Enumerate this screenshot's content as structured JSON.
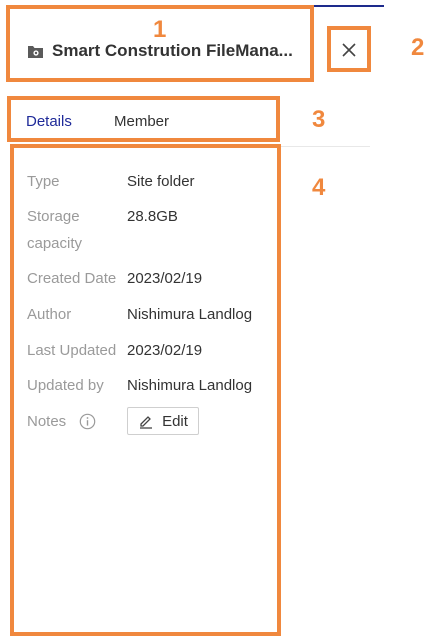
{
  "header": {
    "title": "Smart Constrution FileMana...",
    "close_label": "X"
  },
  "tabs": [
    {
      "label": "Details",
      "active": true
    },
    {
      "label": "Member",
      "active": false
    }
  ],
  "details": {
    "type_label": "Type",
    "type_value": "Site folder",
    "storage_label": "Storage capacity",
    "storage_value": "28.8GB",
    "created_label": "Created Date",
    "created_value": "2023/02/19",
    "author_label": "Author",
    "author_value": "Nishimura Landlog",
    "updated_label": "Last Updated",
    "updated_value": "2023/02/19",
    "updated_by_label": "Updated by",
    "updated_by_value": "Nishimura Landlog",
    "notes_label": "Notes",
    "edit_label": "Edit"
  },
  "annotations": [
    "1",
    "2",
    "3",
    "4"
  ],
  "colors": {
    "annotation": "#f0883e",
    "active_tab": "#1f2a99",
    "label": "#9a9a9a",
    "text": "#333333"
  },
  "icons": {
    "folder": "site-folder-icon",
    "info": "info-icon",
    "edit": "pencil-icon"
  }
}
